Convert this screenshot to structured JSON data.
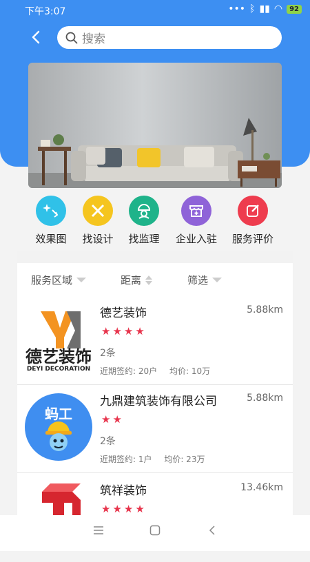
{
  "status": {
    "time": "下午3:07",
    "battery": "92"
  },
  "search": {
    "placeholder": "搜索"
  },
  "categories": [
    {
      "label": "效果图",
      "color": "#30c1e8",
      "icon": "sparkle-icon"
    },
    {
      "label": "找设计",
      "color": "#f5c51f",
      "icon": "pencil-ruler-icon"
    },
    {
      "label": "找监理",
      "color": "#1fb38a",
      "icon": "hardhat-worker-icon"
    },
    {
      "label": "企业入驻",
      "color": "#8f63d8",
      "icon": "storefront-plus-icon"
    },
    {
      "label": "服务评价",
      "color": "#ee3c4e",
      "icon": "edit-icon"
    }
  ],
  "filters": [
    {
      "label": "服务区域"
    },
    {
      "label": "距离"
    },
    {
      "label": "筛选"
    }
  ],
  "companies": [
    {
      "name": "德艺装饰",
      "distance": "5.88km",
      "stars": 4,
      "count": "2条",
      "recent_label": "近期签约: 20户",
      "price_label": "均价: 10万",
      "logo_text": "德艺装饰",
      "logo_sub": "DEYI DECORATION"
    },
    {
      "name": "九鼎建筑装饰有限公司",
      "distance": "5.88km",
      "stars": 2,
      "count": "2条",
      "recent_label": "近期签约: 1户",
      "price_label": "均价: 23万",
      "logo_text": "蚂工"
    },
    {
      "name": "筑祥装饰",
      "distance": "13.46km",
      "stars": 4
    }
  ]
}
